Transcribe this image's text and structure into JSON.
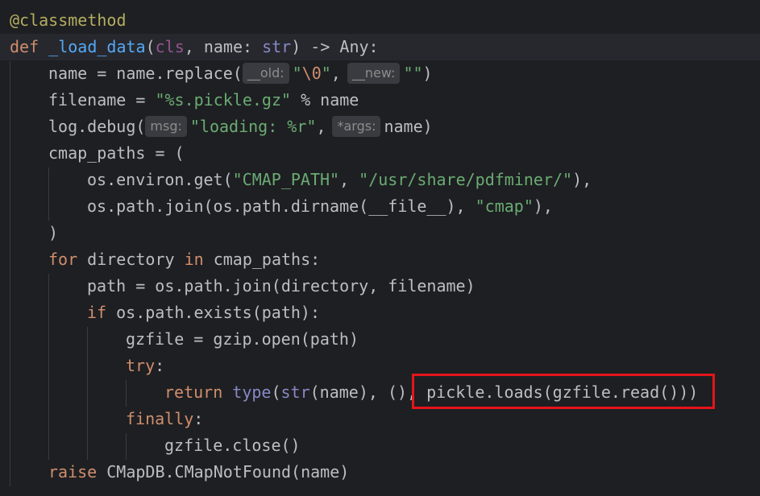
{
  "lines": [
    {
      "decorator": "@classmethod"
    },
    {
      "kw_def": "def",
      "fn_name": "_load_data",
      "open": "(",
      "cls": "cls",
      "rest1": ", name: ",
      "type_str": "str",
      "rest2": ") -> Any:"
    },
    {
      "pre": "name = name.replace(",
      "hint1": "__old:",
      "str1": "\"",
      "esc": "\\0",
      "str1_end": "\"",
      "comma": ",",
      "hint2": "__new:",
      "str2": "\"\"",
      "post": ")"
    },
    {
      "pre": "filename = ",
      "str": "\"%s.pickle.gz\"",
      "post": " % name"
    },
    {
      "pre": "log.debug(",
      "hint1": "msg:",
      "str": "\"loading: %r\"",
      "comma": ",",
      "hint2": "*args:",
      "post": "name)"
    },
    {
      "text": "cmap_paths = ("
    },
    {
      "pre": "os.environ.get(",
      "str1": "\"CMAP_PATH\"",
      "mid": ", ",
      "str2": "\"/usr/share/pdfminer/\"",
      "post": "),"
    },
    {
      "pre": "os.path.join(os.path.dirname(__file__), ",
      "str": "\"cmap\"",
      "post": "),"
    },
    {
      "text": ")"
    },
    {
      "kw1": "for",
      "mid1": " directory ",
      "kw2": "in",
      "mid2": " cmap_paths:"
    },
    {
      "text": "path = os.path.join(directory, filename)"
    },
    {
      "kw": "if",
      "post": " os.path.exists(path):"
    },
    {
      "text": "gzfile = gzip.open(path)"
    },
    {
      "kw": "try",
      "post": ":"
    },
    {
      "kw": "return",
      "sp": " ",
      "builtin1": "type",
      "open": "(",
      "builtin2": "str",
      "post": "(name), (), ",
      "highlighted": "pickle.loads(gzfile.read()))"
    },
    {
      "kw": "finally",
      "post": ":"
    },
    {
      "text": "gzfile.close()"
    },
    {
      "kw": "raise",
      "post": " CMapDB.CMapNotFound(name)"
    }
  ],
  "colors": {
    "background": "#1e1f22",
    "keyword": "#cf8e6d",
    "function": "#56a8f5",
    "string": "#6aab73",
    "decorator": "#b3ae60",
    "highlight_border": "#e3151a"
  }
}
